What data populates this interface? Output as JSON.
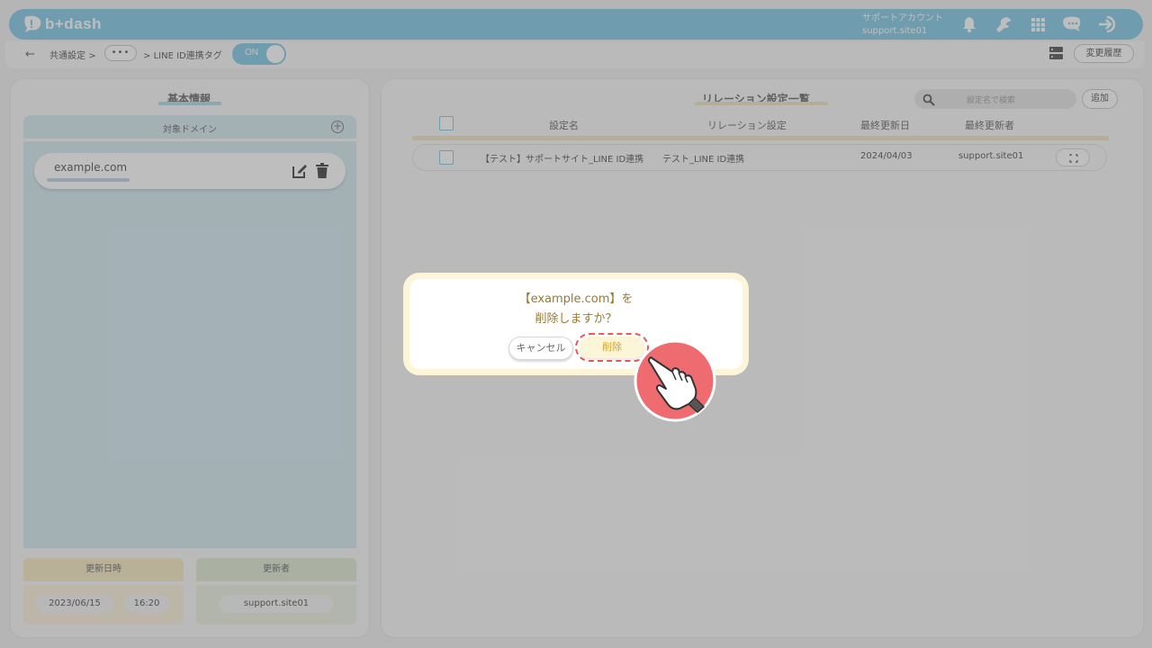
{
  "colors": {
    "header": "#8ed0ea",
    "accent_yellow": "#fdf5d8",
    "danger_red": "#e65a5a",
    "dialog_text": "#9a7a2e"
  },
  "header": {
    "logo_text": "b+dash",
    "account_label": "サポートアカウント",
    "account_id": "support.site01",
    "icons": [
      "bell-icon",
      "wrench-icon",
      "grid-icon",
      "chat-icon",
      "logout-icon"
    ]
  },
  "breadcrumb": {
    "items": [
      "共通設定",
      "LINE ID連携タグ"
    ],
    "separator": ">",
    "dots": "•••"
  },
  "toggle": {
    "label": "ON",
    "state": "on"
  },
  "history_button": "変更履歴",
  "left_panel": {
    "title": "基本情報",
    "domain_header": "対象ドメイン",
    "domains": [
      "example.com"
    ],
    "updated_at_label": "更新日時",
    "updated_date": "2023/06/15",
    "updated_time": "16:20",
    "updated_by_label": "更新者",
    "updated_by": "support.site01"
  },
  "right_panel": {
    "title": "リレーション設定一覧",
    "search_placeholder": "設定名で検索",
    "add_button": "追加",
    "columns": [
      "設定名",
      "リレーション設定",
      "最終更新日",
      "最終更新者"
    ],
    "rows": [
      {
        "name": "【テスト】サポートサイト_LINE ID連携",
        "relation": "テスト_LINE ID連携",
        "updated": "2024/04/03",
        "updater": "support.site01"
      }
    ]
  },
  "dialog": {
    "line1": "【example.com】を",
    "line2": "削除しますか？",
    "cancel": "キャンセル",
    "delete": "削除"
  }
}
